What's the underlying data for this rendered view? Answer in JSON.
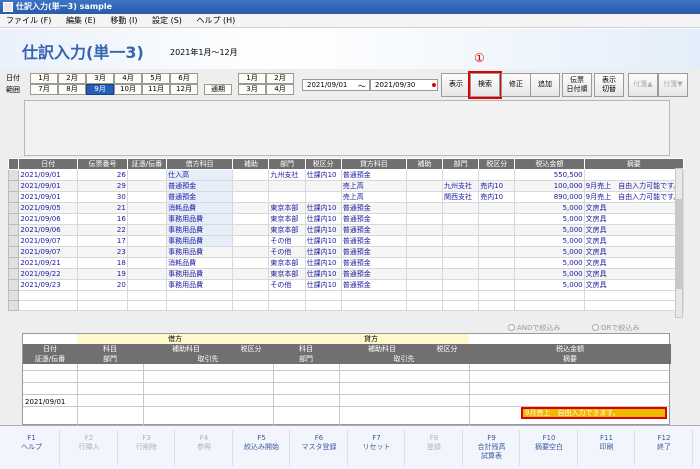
{
  "window": {
    "title": "仕訳入力(単一3) sample"
  },
  "menu": [
    "ファイル (F)",
    "編集 (E)",
    "移動 (I)",
    "設定 (S)",
    "ヘルプ (H)"
  ],
  "header": {
    "title": "仕訳入力(単一3)",
    "period": "2021年1月～12月"
  },
  "period_labels": {
    "line1": "日付",
    "line2": "範囲"
  },
  "months_row1": [
    "1月",
    "2月",
    "3月",
    "4月",
    "5月",
    "6月"
  ],
  "months_row2": [
    "7月",
    "8月",
    "9月",
    "10月",
    "11月",
    "12月"
  ],
  "selected_month": "9月",
  "kessan": "通期",
  "quarter_row1": [
    "1月",
    "2月"
  ],
  "quarter_row2": [
    "3月",
    "4月"
  ],
  "date_from": "2021/09/01",
  "date_sep": "～",
  "date_to": "2021/09/30",
  "annotation": "①",
  "actions": {
    "show": "表示",
    "search": "検索",
    "fix": "修正",
    "add": "追加",
    "date_order_1": "伝票",
    "date_order_2": "日付順",
    "switch_1": "表示",
    "switch_2": "切替",
    "tag_up": "付箋▲",
    "tag_down": "付箋▼"
  },
  "grid": {
    "headers": [
      "日付",
      "伝票番号",
      "証憑/伝番",
      "借方科目",
      "補助",
      "部門",
      "税区分",
      "貸方科目",
      "補助",
      "部門",
      "税区分",
      "税込金額",
      "摘要"
    ],
    "rows": [
      [
        "2021/09/01",
        "26",
        "",
        "仕入高",
        "",
        "九州支社",
        "仕課内10",
        "普通預金",
        "",
        "",
        "",
        "550,500",
        ""
      ],
      [
        "2021/09/01",
        "29",
        "",
        "普通預金",
        "",
        "",
        "",
        "売上高",
        "",
        "九州支社",
        "売内10",
        "100,000",
        "9月売上　自由入力可能です。"
      ],
      [
        "2021/09/01",
        "30",
        "",
        "普通預金",
        "",
        "",
        "",
        "売上高",
        "",
        "関西支社",
        "売内10",
        "890,000",
        "9月売上　自由入力可能です。"
      ],
      [
        "2021/09/05",
        "21",
        "",
        "消耗品費",
        "",
        "東京本部",
        "仕課内10",
        "普通預金",
        "",
        "",
        "",
        "5,000",
        "文房具"
      ],
      [
        "2021/09/06",
        "16",
        "",
        "事務用品費",
        "",
        "東京本部",
        "仕課内10",
        "普通預金",
        "",
        "",
        "",
        "5,000",
        "文房具"
      ],
      [
        "2021/09/06",
        "22",
        "",
        "事務用品費",
        "",
        "東京本部",
        "仕課内10",
        "普通預金",
        "",
        "",
        "",
        "5,000",
        "文房具"
      ],
      [
        "2021/09/07",
        "17",
        "",
        "事務用品費",
        "",
        "その他",
        "仕課内10",
        "普通預金",
        "",
        "",
        "",
        "5,000",
        "文房具"
      ],
      [
        "2021/09/07",
        "23",
        "",
        "事務用品費",
        "",
        "その他",
        "仕課内10",
        "普通預金",
        "",
        "",
        "",
        "5,000",
        "文房具"
      ],
      [
        "2021/09/21",
        "18",
        "",
        "消耗品費",
        "",
        "東京本部",
        "仕課内10",
        "普通預金",
        "",
        "",
        "",
        "5,000",
        "文房具"
      ],
      [
        "2021/09/22",
        "19",
        "",
        "事務用品費",
        "",
        "東京本部",
        "仕課内10",
        "普通預金",
        "",
        "",
        "",
        "5,000",
        "文房具"
      ],
      [
        "2021/09/23",
        "20",
        "",
        "事務用品費",
        "",
        "その他",
        "仕課内10",
        "普通預金",
        "",
        "",
        "",
        "5,000",
        "文房具"
      ]
    ]
  },
  "filters": {
    "and": "ANDで絞込み",
    "or": "ORで絞込み"
  },
  "entry": {
    "debit": "借方",
    "credit": "貸方",
    "date": "日付",
    "voucher": "証憑/伝番",
    "d_account": "科目",
    "d_sub": "補助科目",
    "d_tax": "税区分",
    "d_dept": "部門",
    "d_partner": "取引先",
    "c_account": "科目",
    "c_sub": "補助科目",
    "c_tax": "税区分",
    "c_dept": "部門",
    "c_partner": "取引先",
    "amount": "税込金額",
    "memo": "摘要",
    "date_value": "2021/09/01",
    "memo_value": "9月売上　自由入力できます。"
  },
  "fkeys": [
    {
      "key": "F1",
      "label": "ヘルプ",
      "enabled": true
    },
    {
      "key": "F2",
      "label": "行挿入",
      "enabled": false
    },
    {
      "key": "F3",
      "label": "行削除",
      "enabled": false
    },
    {
      "key": "F4",
      "label": "参照",
      "enabled": false
    },
    {
      "key": "F5",
      "label": "絞込み開始",
      "enabled": true
    },
    {
      "key": "F6",
      "label": "マスタ登録",
      "enabled": true
    },
    {
      "key": "F7",
      "label": "リセット",
      "enabled": true
    },
    {
      "key": "F8",
      "label": "登録",
      "enabled": false
    },
    {
      "key": "F9",
      "label": "合計残高\n試算表",
      "enabled": true
    },
    {
      "key": "F10",
      "label": "摘要空白",
      "enabled": true
    },
    {
      "key": "F11",
      "label": "印刷",
      "enabled": true
    },
    {
      "key": "F12",
      "label": "終了",
      "enabled": true
    }
  ]
}
